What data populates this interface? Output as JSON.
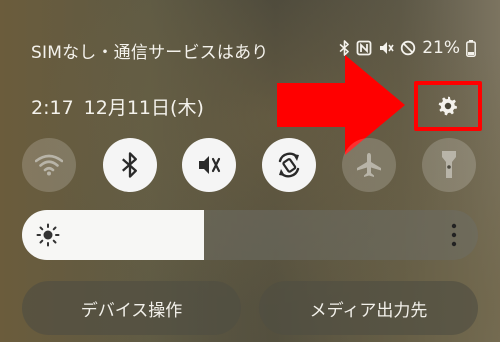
{
  "statusbar": {
    "carrier": "SIMなし・通信サービスはあり",
    "battery": "21%",
    "icons": [
      "bluetooth-icon",
      "nfc-icon",
      "mute-icon",
      "do-not-disturb-icon",
      "battery-icon"
    ]
  },
  "header": {
    "time": "2:17",
    "date": "12月11日(木)"
  },
  "annotation": {
    "color": "#ff0000",
    "target": "settings-button"
  },
  "quick_toggles": [
    {
      "name": "wifi",
      "icon": "wifi-icon",
      "state": "off"
    },
    {
      "name": "bluetooth",
      "icon": "bluetooth-icon",
      "state": "on"
    },
    {
      "name": "mute",
      "icon": "mute-icon",
      "state": "on"
    },
    {
      "name": "auto-rotate",
      "icon": "rotate-icon",
      "state": "on"
    },
    {
      "name": "airplane-mode",
      "icon": "airplane-icon",
      "state": "off"
    },
    {
      "name": "flashlight",
      "icon": "flashlight-icon",
      "state": "off"
    }
  ],
  "brightness": {
    "level": 0.4,
    "icon": "sun-icon"
  },
  "buttons": {
    "device_control": "デバイス操作",
    "media_output": "メディア出力先"
  }
}
